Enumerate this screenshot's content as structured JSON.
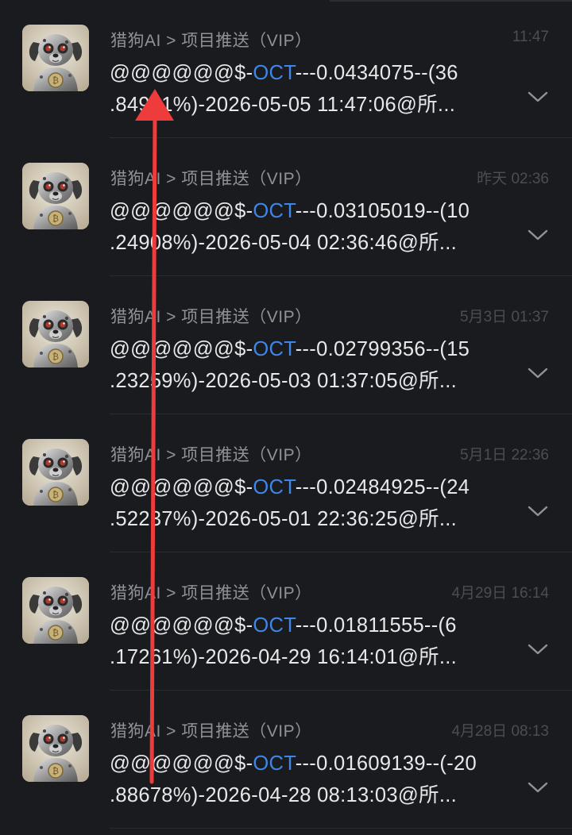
{
  "colors": {
    "background": "#1a1b1f",
    "token_link": "#3e86e8",
    "message_text": "#e8e8ea",
    "sender_text": "#8f9298",
    "time_text": "#4a4d53",
    "annotation_arrow": "#ee3b3b"
  },
  "messages": [
    {
      "avatar_icon": "robot-dog-bitcoin-icon",
      "sender": "猎狗AI > 项目推送（VIP）",
      "time": "11:47",
      "prefix": "@@@@@@$-",
      "token": "OCT",
      "line1_rest": "---0.0434075--(36",
      "line2": ".84941%)-2026-05-05 11:47:06@所..."
    },
    {
      "avatar_icon": "robot-dog-bitcoin-icon",
      "sender": "猎狗AI > 项目推送（VIP）",
      "time": "昨天 02:36",
      "prefix": "@@@@@@$-",
      "token": "OCT",
      "line1_rest": "---0.03105019--(10",
      "line2": ".24908%)-2026-05-04 02:36:46@所..."
    },
    {
      "avatar_icon": "robot-dog-bitcoin-icon",
      "sender": "猎狗AI > 项目推送（VIP）",
      "time": "5月3日 01:37",
      "prefix": "@@@@@@$-",
      "token": "OCT",
      "line1_rest": "---0.02799356--(15",
      "line2": ".23259%)-2026-05-03 01:37:05@所..."
    },
    {
      "avatar_icon": "robot-dog-bitcoin-icon",
      "sender": "猎狗AI > 项目推送（VIP）",
      "time": "5月1日 22:36",
      "prefix": "@@@@@@$-",
      "token": "OCT",
      "line1_rest": "---0.02484925--(24",
      "line2": ".52237%)-2026-05-01 22:36:25@所..."
    },
    {
      "avatar_icon": "robot-dog-bitcoin-icon",
      "sender": "猎狗AI > 项目推送（VIP）",
      "time": "4月29日 16:14",
      "prefix": "@@@@@@$-",
      "token": "OCT",
      "line1_rest": "---0.01811555--(6",
      "line2": ".17261%)-2026-04-29 16:14:01@所..."
    },
    {
      "avatar_icon": "robot-dog-bitcoin-icon",
      "sender": "猎狗AI > 项目推送（VIP）",
      "time": "4月28日 08:13",
      "prefix": "@@@@@@$-",
      "token": "OCT",
      "line1_rest": "---0.01609139--(-20",
      "line2": ".88678%)-2026-04-28 08:13:03@所..."
    }
  ]
}
